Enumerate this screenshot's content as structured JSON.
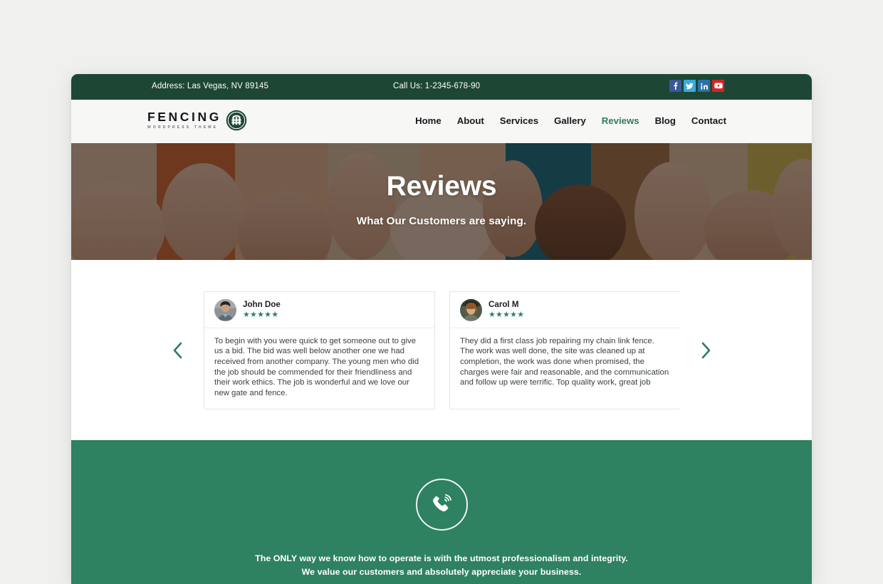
{
  "topbar": {
    "address": "Address: Las Vegas, NV 89145",
    "phone": "Call Us: 1-2345-678-90",
    "social": [
      {
        "name": "facebook-icon",
        "label": "f",
        "color": "#3b5998"
      },
      {
        "name": "twitter-icon",
        "label": "t",
        "color": "#3aa9e0"
      },
      {
        "name": "linkedin-icon",
        "label": "in",
        "color": "#2a72a8"
      },
      {
        "name": "youtube-icon",
        "label": "y",
        "color": "#d62422"
      }
    ]
  },
  "header": {
    "logo_name": "FENCING",
    "logo_sub": "WORDPRESS THEME",
    "logo_icon": "fence-gate-circle-icon",
    "nav": [
      {
        "label": "Home",
        "active": false
      },
      {
        "label": "About",
        "active": false
      },
      {
        "label": "Services",
        "active": false
      },
      {
        "label": "Gallery",
        "active": false
      },
      {
        "label": "Reviews",
        "active": true
      },
      {
        "label": "Blog",
        "active": false
      },
      {
        "label": "Contact",
        "active": false
      }
    ]
  },
  "hero": {
    "title": "Reviews",
    "subtitle": "What Our Customers are saying.",
    "background": "thumbs-up-hands-photo"
  },
  "carousel": {
    "prev_icon": "chevron-left-icon",
    "next_icon": "chevron-right-icon",
    "stars": "★★★★★",
    "reviews": [
      {
        "name": "John Doe",
        "rating": 5,
        "avatar": "male-avatar-photo",
        "text": "To begin with you were quick to get someone out to give us a bid. The bid was well below another one we had received from another company. The young men who did the job should be commended for their friendliness and their work ethics. The job is wonderful and we love our new gate and fence."
      },
      {
        "name": "Carol M",
        "rating": 5,
        "avatar": "female-avatar-photo",
        "text": "They did a first class job repairing my chain link fence. The work was well done, the site was cleaned up at completion, the work was done when promised, the charges were fair and reasonable, and the communication and follow up were terrific. Top quality work, great job"
      }
    ]
  },
  "cta": {
    "icon": "phone-ringing-icon",
    "line1": "The ONLY way we know how to operate is with the utmost professionalism and integrity.",
    "line2": "We value our customers and absolutely appreciate your business."
  },
  "colors": {
    "dark_green": "#1d4734",
    "brand_green": "#2e8161",
    "nav_active": "#2e7d5a",
    "page_bg": "#f0f0ef",
    "navbar_bg": "#f7f7f5"
  }
}
